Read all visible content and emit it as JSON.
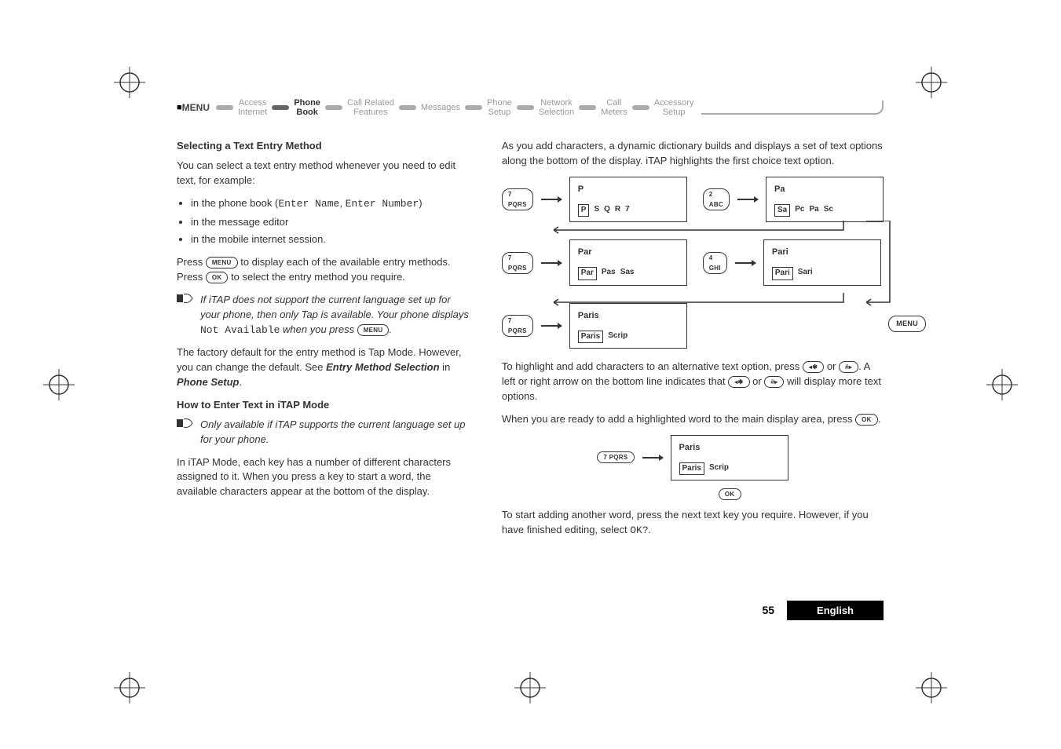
{
  "nav": {
    "menuLabel": "MENU",
    "items": [
      {
        "line1": "Access",
        "line2": "Internet"
      },
      {
        "line1": "Phone",
        "line2": "Book"
      },
      {
        "line1": "Call Related",
        "line2": "Features"
      },
      {
        "line1": "Messages",
        "line2": ""
      },
      {
        "line1": "Phone",
        "line2": "Setup"
      },
      {
        "line1": "Network",
        "line2": "Selection"
      },
      {
        "line1": "Call",
        "line2": "Meters"
      },
      {
        "line1": "Accessory",
        "line2": "Setup"
      }
    ]
  },
  "left": {
    "h1": "Selecting a Text Entry Method",
    "p1": "You can select a text entry method whenever you need to edit text, for example:",
    "li1a": "in the phone book (",
    "li1b": "Enter Name",
    "li1c": ", ",
    "li1d": "Enter Number",
    "li1e": ")",
    "li2": "in the message editor",
    "li3": "in the mobile internet session.",
    "p2a": "Press ",
    "p2b": " to display each of the available entry methods. Press ",
    "p2c": " to select the entry method you require.",
    "note1a": "If iTAP does not support the current language set up for your phone, then only Tap is available. Your phone displays ",
    "note1b": "Not Available",
    "note1c": " when you press ",
    "note1d": ".",
    "p3a": "The factory default for the entry method is Tap Mode. However, you can change the default. See ",
    "p3b": "Entry Method Selection",
    "p3c": " in ",
    "p3d": "Phone Setup",
    "p3e": ".",
    "h2": "How to Enter Text in iTAP Mode",
    "note2": "Only available if iTAP supports the current language set up for your phone.",
    "p4": "In iTAP Mode, each key has a number of different characters assigned to it. When you press a key to start a word, the available characters appear at the bottom of the display."
  },
  "right": {
    "p1": "As you add characters, a dynamic dictionary builds and displays a set of text options along the bottom of the display. iTAP highlights the first choice text option.",
    "screens": {
      "s1": {
        "top": "P",
        "opts": [
          "P",
          "S",
          "Q",
          "R",
          "7"
        ],
        "boxed": 0
      },
      "s2": {
        "top": "Pa",
        "opts": [
          "Sa",
          "Pc",
          "Pa",
          "Sc"
        ],
        "boxed": 0
      },
      "s3": {
        "top": "Par",
        "opts": [
          "Par",
          "Pas",
          "Sas"
        ],
        "boxed": 0
      },
      "s4": {
        "top": "Pari",
        "opts": [
          "Pari",
          "Sari"
        ],
        "boxed": 0
      },
      "s5": {
        "top": "Paris",
        "opts": [
          "Paris",
          "Scrip"
        ],
        "boxed": 0
      }
    },
    "keys": {
      "k7": "7 PQRS",
      "k2": "2 ABC",
      "k4": "4 GHI"
    },
    "menuLabel": "MENU",
    "p2a": "To highlight and add characters to an alternative text option, press ",
    "p2b": " or ",
    "p2c": ". A left or right arrow on the bottom line indicates that ",
    "p2d": " or ",
    "p2e": " will display more text options.",
    "p3a": "When you are ready to add a highlighted word to the main display area, press ",
    "p3b": ".",
    "single": {
      "top": "Paris",
      "opts": [
        "Paris",
        "Scrip"
      ],
      "boxed": 0
    },
    "p4a": "To start adding another word, press the next text key you require. However, if you have finished editing, select ",
    "p4b": "OK?",
    "p4c": "."
  },
  "keycaps": {
    "menu": "MENU",
    "ok": "OK",
    "star": "◂✱",
    "hash": "#▸"
  },
  "footer": {
    "page": "55",
    "lang": "English"
  }
}
